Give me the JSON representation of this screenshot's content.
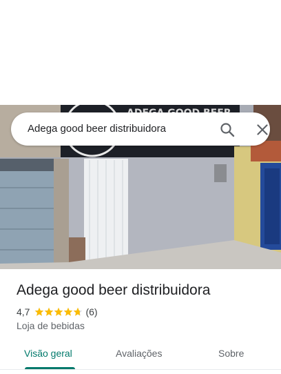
{
  "search": {
    "query": "Adega good beer distribuidora"
  },
  "photo": {
    "sign_text": "ADEGA GOOD BEER"
  },
  "place": {
    "name": "Adega good beer distribuidora",
    "rating": "4,7",
    "stars": 4.7,
    "reviews": "(6)",
    "category": "Loja de bebidas"
  },
  "tabs": [
    {
      "label": "Visão geral",
      "active": true
    },
    {
      "label": "Avaliações",
      "active": false
    },
    {
      "label": "Sobre",
      "active": false
    }
  ],
  "colors": {
    "accent": "#00796b",
    "star": "#fbbc04"
  }
}
